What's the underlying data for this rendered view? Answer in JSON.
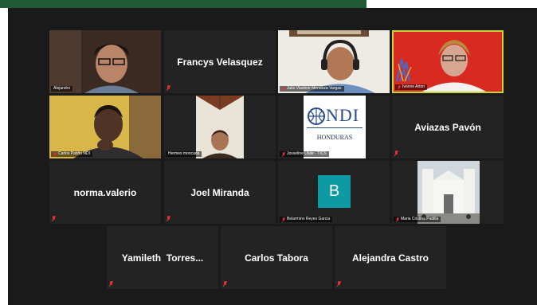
{
  "participants": [
    {
      "label": "Alejandro"
    },
    {
      "name": "Francys Velasquez"
    },
    {
      "label": "Julio Vladimir Mendoza Vargas"
    },
    {
      "label": "Ivonne Arton"
    },
    {
      "label": "Carlos Patiño NDI"
    },
    {
      "label": "Hermes moncada"
    },
    {
      "label": "Josseline Ulate - TICS"
    },
    {
      "name": "Aviazas Pavón"
    },
    {
      "name": "norma.valerio"
    },
    {
      "name": "Joel Miranda"
    },
    {
      "label": "Belarmino Reyes Garcia",
      "avatar": "B"
    },
    {
      "label": "Maria Cristina Padilla"
    },
    {
      "name": "Yamileth  Torres..."
    },
    {
      "name": "Carlos Tabora"
    },
    {
      "name": "Alejandra Castro"
    }
  ],
  "ndi_logo": {
    "brand": "NDI",
    "country": "HONDURAS"
  },
  "colors": {
    "topbar": "#1f5c34",
    "stage": "#1a1a1a",
    "tile": "#232323",
    "active_speaker": "#c8d23a",
    "avatar": "#0e9aa5",
    "mic_muted": "#e5322e"
  }
}
